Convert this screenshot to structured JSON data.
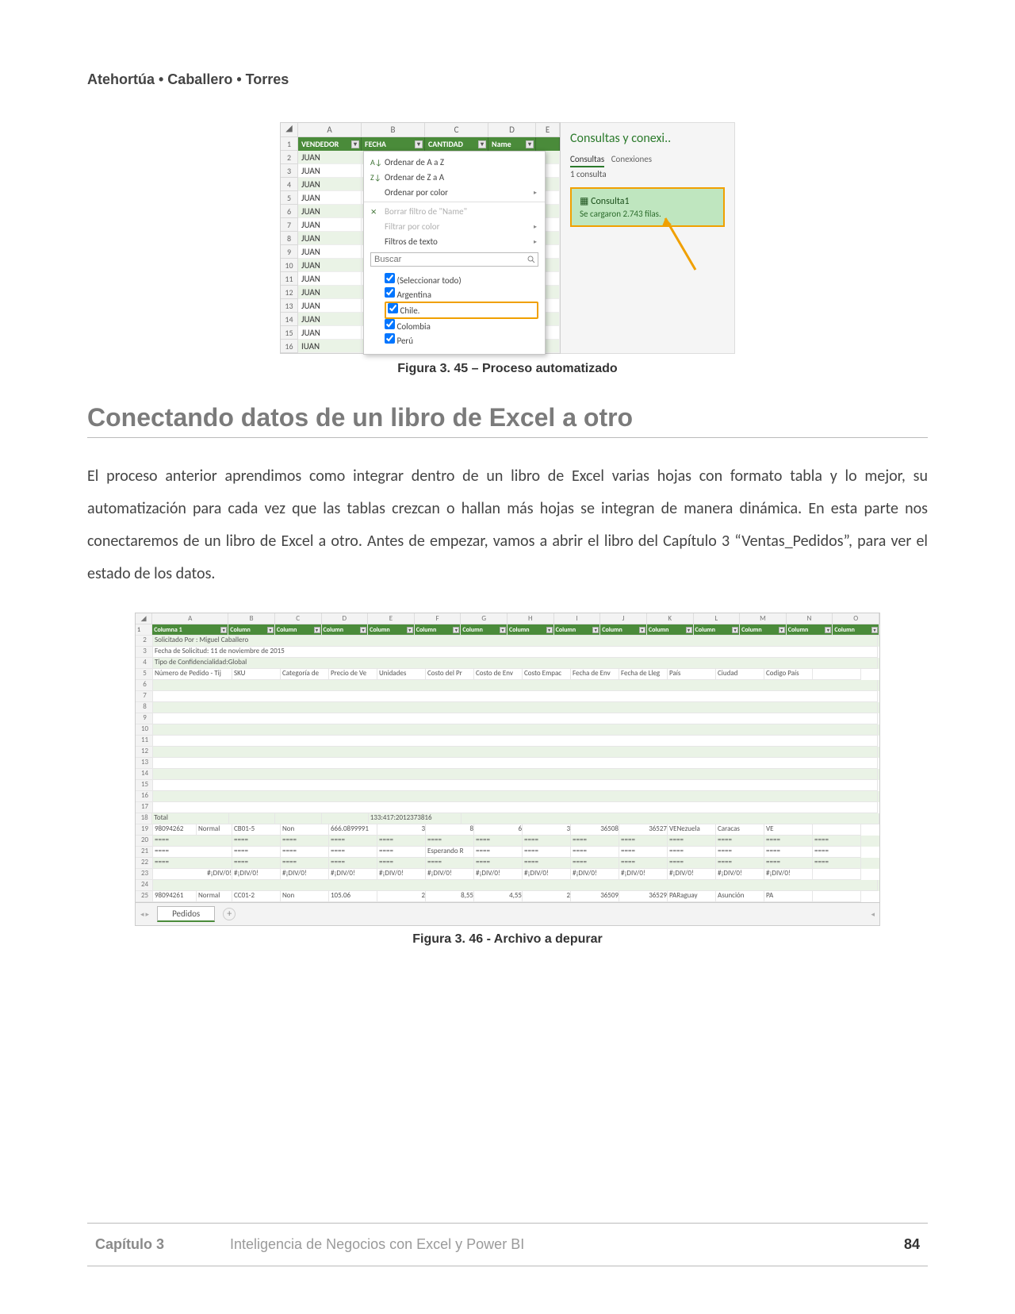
{
  "header": {
    "authors": "Atehortúa • Caballero • Torres"
  },
  "figure1": {
    "columns": [
      "A",
      "B",
      "C",
      "D",
      "E"
    ],
    "headers": {
      "vendedor": "VENDEDOR",
      "fecha": "FECHA",
      "cantidad": "CANTIDAD",
      "name": "Name"
    },
    "rows": [
      "1",
      "2",
      "3",
      "4",
      "5",
      "6",
      "7",
      "8",
      "9",
      "10",
      "11",
      "12",
      "13",
      "14",
      "15",
      "16"
    ],
    "cell_value": "JUAN",
    "last_cell_value": "IUAN",
    "filter": {
      "sort_az": "Ordenar de A a Z",
      "sort_za": "Ordenar de Z a A",
      "sort_color": "Ordenar por color",
      "clear_filter": "Borrar filtro de \"Name\"",
      "filter_color": "Filtrar por color",
      "text_filters": "Filtros de texto",
      "search_placeholder": "Buscar",
      "select_all": "(Seleccionar todo)",
      "options": [
        "Argentina",
        "Chile.",
        "Colombia",
        "Perú"
      ]
    },
    "panel": {
      "title": "Consultas y conexi..",
      "tab1": "Consultas",
      "tab2": "Conexiones",
      "count": "1 consulta",
      "query_name": "Consulta1",
      "query_status": "Se cargaron 2.743 filas."
    },
    "caption": "Figura 3. 45 – Proceso automatizado"
  },
  "heading": "Conectando datos de un libro de Excel a otro",
  "paragraph": "El proceso anterior aprendimos como integrar dentro de un libro de Excel varias hojas con formato tabla y lo mejor, su automatización para cada vez que las tablas crezcan o hallan más hojas se integran de manera dinámica. En esta parte nos conectaremos de un libro de Excel a otro. Antes de empezar, vamos a abrir el libro del Capítulo 3 “Ventas_Pedidos”, para ver el estado de los datos.",
  "figure2": {
    "col_letters": [
      "A",
      "B",
      "C",
      "D",
      "E",
      "F",
      "G",
      "H",
      "I",
      "J",
      "K",
      "L",
      "M",
      "N",
      "O"
    ],
    "green_headers_first": "Columna 1",
    "green_header_generic": "Column",
    "meta_rows": [
      "Solicitado Por : Miguel Caballero",
      "Fecha de Solicitud: 11 de noviembre de 2015",
      "Tipo de Confidencialidad:Global"
    ],
    "field_headers": [
      "Número de Pedido - Tij",
      "SKU",
      "Categoría de",
      "Precio de Ve",
      "Unidades",
      "Costo del Pr",
      "Costo de Env",
      "Costo Empac",
      "Fecha de Env",
      "Fecha de Lleg",
      "País",
      "Ciudad",
      "Codigo País"
    ],
    "row_nums": [
      "1",
      "2",
      "3",
      "4",
      "5",
      "6",
      "7",
      "8",
      "9",
      "10",
      "11",
      "12",
      "13",
      "14",
      "15",
      "16",
      "17",
      "18",
      "19",
      "20",
      "21",
      "22",
      "23",
      "24",
      "25"
    ],
    "total_label": "Total",
    "total_val": "133:417:2012373816",
    "r19": [
      "98094262",
      "Normal",
      "CB01-5",
      "Non",
      "666.0899991",
      "3",
      "8",
      "6",
      "3",
      "36508",
      "36527",
      "VENezuela",
      "Caracas",
      "VE"
    ],
    "r20_dashes": "====",
    "r21_wait": "Esperando R",
    "div0": "#¡DIV/0!",
    "r25": [
      "98094261",
      "Normal",
      "CC01-2",
      "Non",
      "105.06",
      "2",
      "8,55",
      "4,55",
      "2",
      "36509",
      "36529",
      "PARaguay",
      "Asunción",
      "PA"
    ],
    "sheet_tab": "Pedidos",
    "caption": "Figura 3. 46 -  Archivo a depurar"
  },
  "footer": {
    "chapter": "Capítulo 3",
    "book": "Inteligencia de Negocios con Excel y Power BI",
    "page": "84"
  }
}
